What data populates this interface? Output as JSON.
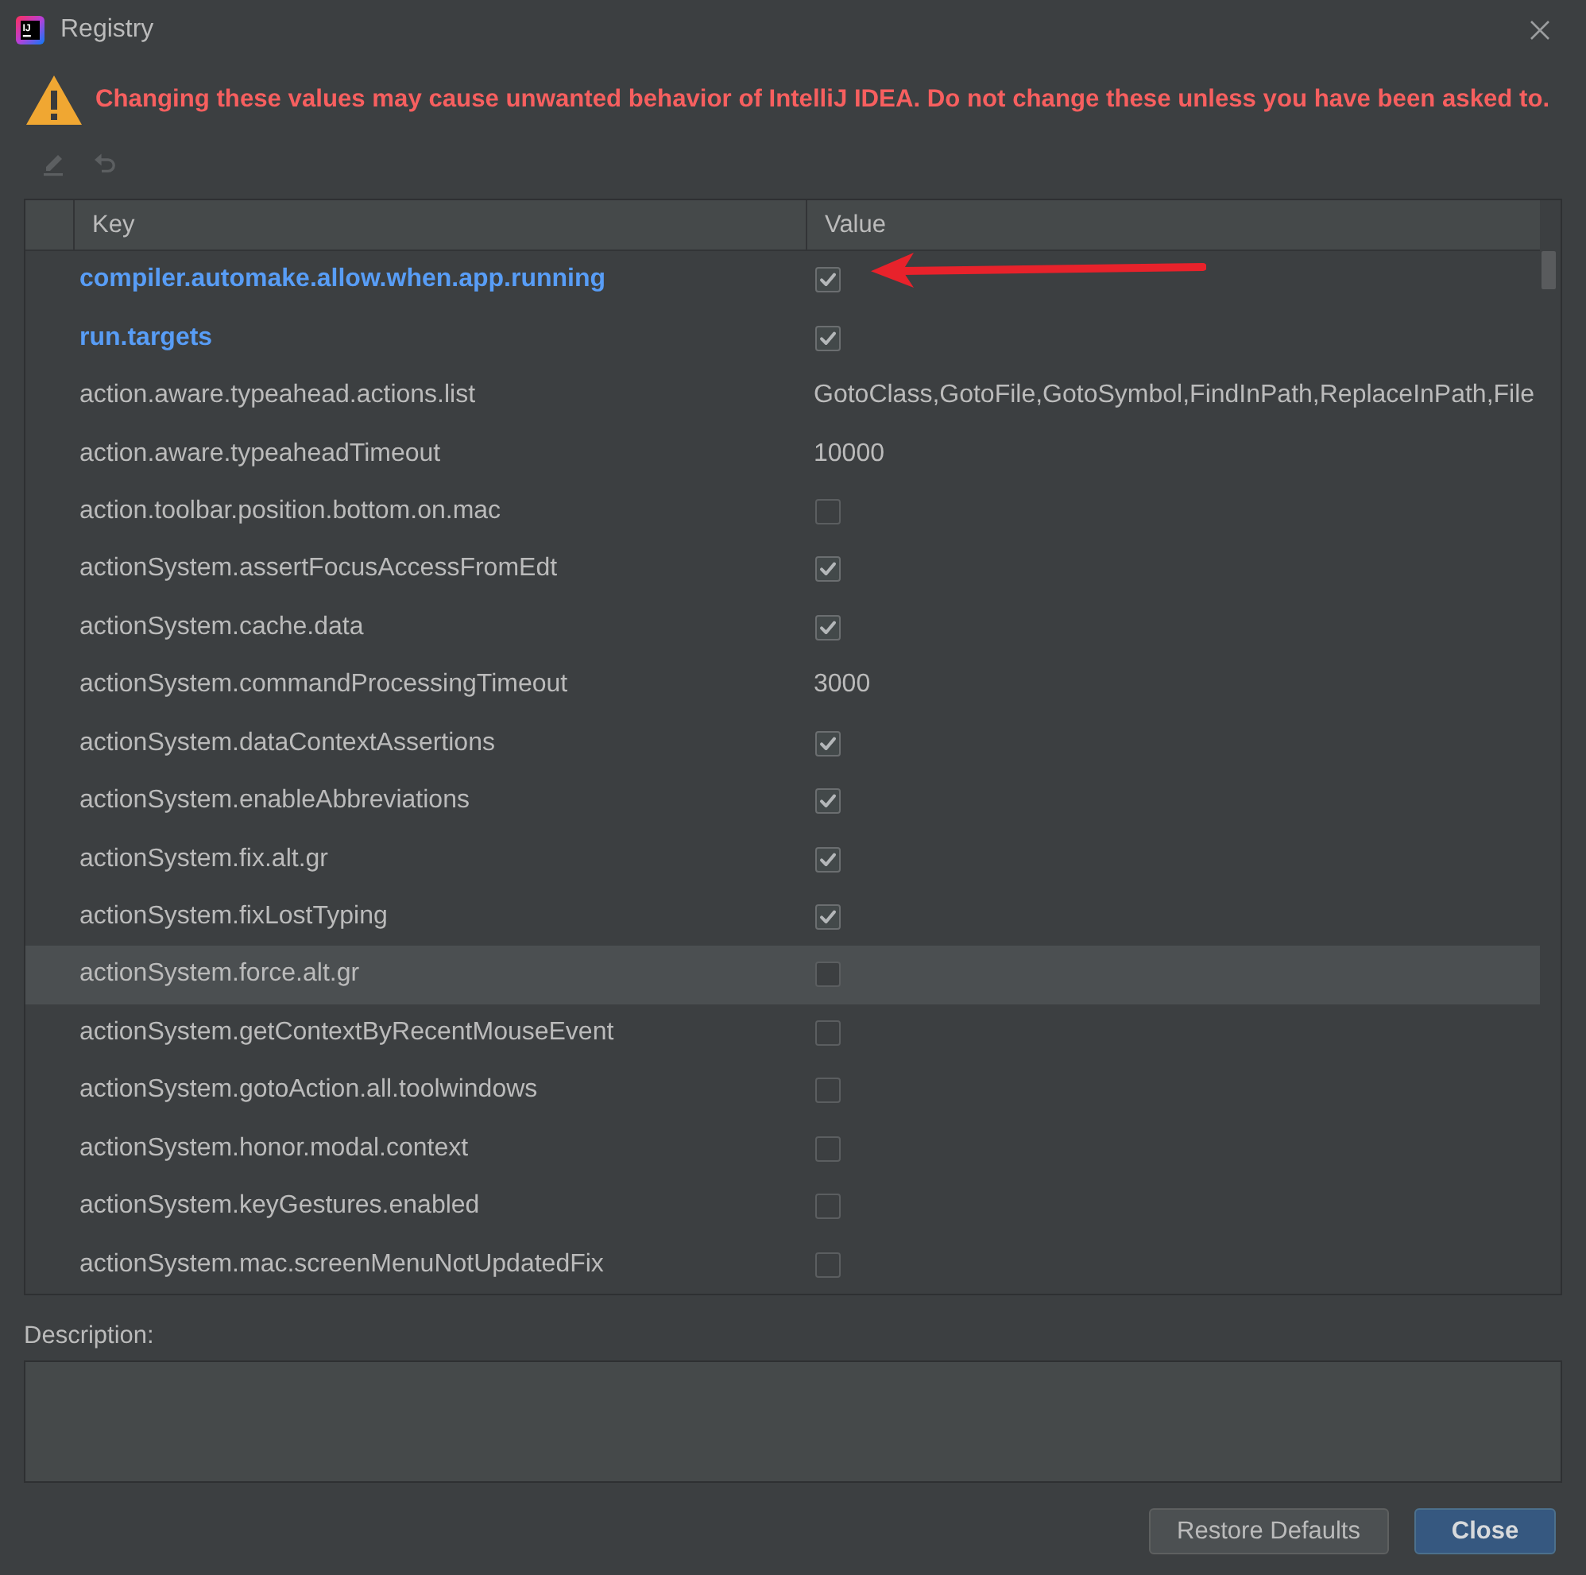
{
  "window": {
    "title": "Registry",
    "logo_text": "IJ"
  },
  "warning": {
    "text": "Changing these values may cause unwanted behavior of IntelliJ IDEA. Do not change these unless you have been asked to."
  },
  "toolbar": [
    {
      "kind": "edit",
      "disabled": true
    },
    {
      "kind": "undo",
      "disabled": true
    }
  ],
  "table": {
    "columns": [
      "Key",
      "Value"
    ],
    "rows": [
      {
        "key": "compiler.automake.allow.when.app.running",
        "modified": true,
        "selected": false,
        "arrow": true,
        "kind": "checkbox",
        "checked": true
      },
      {
        "key": "run.targets",
        "modified": true,
        "selected": false,
        "arrow": false,
        "kind": "checkbox",
        "checked": true
      },
      {
        "key": "action.aware.typeahead.actions.list",
        "modified": false,
        "selected": false,
        "arrow": false,
        "kind": "text",
        "value": "GotoClass,GotoFile,GotoSymbol,FindInPath,ReplaceInPath,File"
      },
      {
        "key": "action.aware.typeaheadTimeout",
        "modified": false,
        "selected": false,
        "arrow": false,
        "kind": "text",
        "value": "10000"
      },
      {
        "key": "action.toolbar.position.bottom.on.mac",
        "modified": false,
        "selected": false,
        "arrow": false,
        "kind": "checkbox",
        "checked": false
      },
      {
        "key": "actionSystem.assertFocusAccessFromEdt",
        "modified": false,
        "selected": false,
        "arrow": false,
        "kind": "checkbox",
        "checked": true
      },
      {
        "key": "actionSystem.cache.data",
        "modified": false,
        "selected": false,
        "arrow": false,
        "kind": "checkbox",
        "checked": true
      },
      {
        "key": "actionSystem.commandProcessingTimeout",
        "modified": false,
        "selected": false,
        "arrow": false,
        "kind": "text",
        "value": "3000"
      },
      {
        "key": "actionSystem.dataContextAssertions",
        "modified": false,
        "selected": false,
        "arrow": false,
        "kind": "checkbox",
        "checked": true
      },
      {
        "key": "actionSystem.enableAbbreviations",
        "modified": false,
        "selected": false,
        "arrow": false,
        "kind": "checkbox",
        "checked": true
      },
      {
        "key": "actionSystem.fix.alt.gr",
        "modified": false,
        "selected": false,
        "arrow": false,
        "kind": "checkbox",
        "checked": true
      },
      {
        "key": "actionSystem.fixLostTyping",
        "modified": false,
        "selected": false,
        "arrow": false,
        "kind": "checkbox",
        "checked": true
      },
      {
        "key": "actionSystem.force.alt.gr",
        "modified": false,
        "selected": true,
        "arrow": false,
        "kind": "checkbox",
        "checked": false
      },
      {
        "key": "actionSystem.getContextByRecentMouseEvent",
        "modified": false,
        "selected": false,
        "arrow": false,
        "kind": "checkbox",
        "checked": false
      },
      {
        "key": "actionSystem.gotoAction.all.toolwindows",
        "modified": false,
        "selected": false,
        "arrow": false,
        "kind": "checkbox",
        "checked": false
      },
      {
        "key": "actionSystem.honor.modal.context",
        "modified": false,
        "selected": false,
        "arrow": false,
        "kind": "checkbox",
        "checked": false
      },
      {
        "key": "actionSystem.keyGestures.enabled",
        "modified": false,
        "selected": false,
        "arrow": false,
        "kind": "checkbox",
        "checked": false
      },
      {
        "key": "actionSystem.mac.screenMenuNotUpdatedFix",
        "modified": false,
        "selected": false,
        "arrow": false,
        "kind": "checkbox",
        "checked": false
      }
    ]
  },
  "description": {
    "label": "Description:"
  },
  "buttons": [
    {
      "label": "Restore Defaults",
      "default": false
    },
    {
      "label": "Close",
      "default": true
    }
  ]
}
